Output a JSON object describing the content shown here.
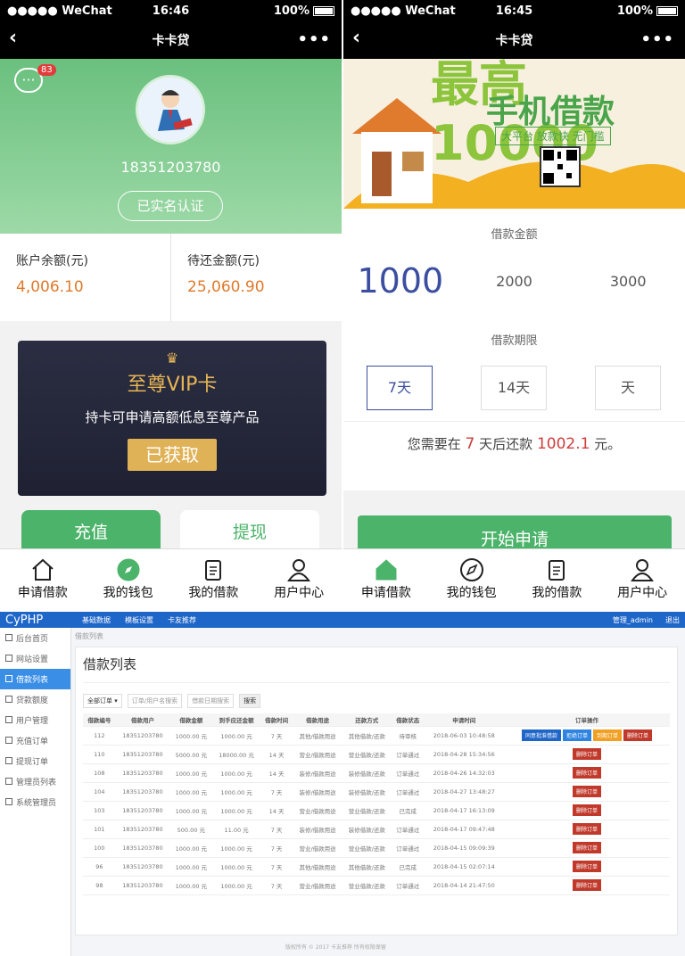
{
  "left": {
    "status": {
      "carrier": "●●●●● WeChat",
      "time": "16:46",
      "battery": "100%"
    },
    "title": "卡卡贷",
    "badge": "83",
    "phone": "18351203780",
    "verified": "已实名认证",
    "balance": {
      "label": "账户余额(元)",
      "value": "4,006.10"
    },
    "due": {
      "label": "待还金额(元)",
      "value": "25,060.90"
    },
    "vip": {
      "title": "至尊VIP卡",
      "desc": "持卡可申请高额低息至尊产品",
      "button": "已获取"
    },
    "recharge": "充值",
    "withdraw": "提现"
  },
  "right": {
    "status": {
      "carrier": "●●●●● WeChat",
      "time": "16:45",
      "battery": "100%"
    },
    "title": "卡卡贷",
    "banner": {
      "big": "最高10000",
      "title": "手机借款",
      "sub": "大平台 放款快 无门槛"
    },
    "amount_label": "借款金额",
    "amounts": [
      "1000",
      "2000",
      "3000"
    ],
    "term_label": "借款期限",
    "terms": [
      "7天",
      "14天",
      "天"
    ],
    "repay": {
      "prefix": "您需要在",
      "days": "7",
      "mid": "天后还款",
      "amount": "1002.1",
      "suffix": "元。"
    },
    "start": "开始申请"
  },
  "tabs": [
    "申请借款",
    "我的钱包",
    "我的借款",
    "用户中心"
  ],
  "admin": {
    "logo": "CyPHP",
    "topnav": [
      "基础数据",
      "模板设置",
      "卡友推荐"
    ],
    "user": "管理_admin",
    "exit": "退出",
    "side": [
      "后台首页",
      "网站设置",
      "借款列表",
      "贷款额度",
      "用户管理",
      "充值订单",
      "提现订单",
      "管理员列表",
      "系统管理员"
    ],
    "crumb": "借款列表",
    "heading": "借款列表",
    "filters": [
      "全部订单 ▾",
      "订单/用户名搜索",
      "借款日期搜索",
      "搜索"
    ],
    "headers": [
      "借款编号",
      "借款用户",
      "借款金额",
      "到手应还金额",
      "借款时间",
      "借款用途",
      "还款方式",
      "借款状态",
      "申请时间",
      "订单操作"
    ],
    "rows": [
      [
        "112",
        "18351203780",
        "1000.00 元",
        "1000.00 元",
        "7 天",
        "其他/借款用途",
        "其他借款/还款",
        "待审核",
        "2018-06-03 10:48:58"
      ],
      [
        "110",
        "18351203780",
        "5000.00 元",
        "18000.00 元",
        "14 天",
        "营业/借款用途",
        "营业借款/还款",
        "订单通过",
        "2018-04-28 15:34:56"
      ],
      [
        "108",
        "18351203780",
        "1000.00 元",
        "1000.00 元",
        "14 天",
        "装修/借款用途",
        "装修借款/还款",
        "订单通过",
        "2018-04-26 14:32:03"
      ],
      [
        "104",
        "18351203780",
        "1000.00 元",
        "1000.00 元",
        "7 天",
        "装修/借款用途",
        "装修借款/还款",
        "订单通过",
        "2018-04-27 13:48:27"
      ],
      [
        "103",
        "18351203780",
        "1000.00 元",
        "1000.00 元",
        "14 天",
        "营业/借款用途",
        "营业借款/还款",
        "已完成",
        "2018-04-17 16:13:09"
      ],
      [
        "101",
        "18351203780",
        "500.00 元",
        "11.00 元",
        "7 天",
        "装修/借款用途",
        "装修借款/还款",
        "订单通过",
        "2018-04-17 09:47:48"
      ],
      [
        "100",
        "18351203780",
        "1000.00 元",
        "1000.00 元",
        "7 天",
        "营业/借款用途",
        "营业借款/还款",
        "订单通过",
        "2018-04-15 09:09:39"
      ],
      [
        "96",
        "18351203780",
        "1000.00 元",
        "1000.00 元",
        "7 天",
        "其他/借款用途",
        "其他借款/还款",
        "已完成",
        "2018-04-15 02:07:14"
      ],
      [
        "98",
        "18351203780",
        "1000.00 元",
        "1000.00 元",
        "7 天",
        "营业/借款用途",
        "营业借款/还款",
        "订单通过",
        "2018-04-14 21:47:50"
      ]
    ],
    "ops": [
      "同意批准借款",
      "拒绝订单",
      "到期订单",
      "删除订单"
    ],
    "footer": "版权所有 © 2017 卡友推荐 所有权限保留"
  }
}
